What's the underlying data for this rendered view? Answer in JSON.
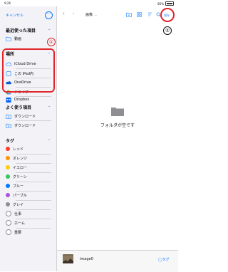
{
  "status": {
    "time": "9:26",
    "right": "85%"
  },
  "sidebar": {
    "cancel": "キャンセル",
    "recent": {
      "header": "最近使った項目",
      "items": [
        {
          "label": "動画"
        }
      ]
    },
    "locations": {
      "header": "場所",
      "items": [
        {
          "label": "iCloud Drive",
          "icon": "cloud-icon"
        },
        {
          "label": "この iPad内",
          "icon": "ipad-icon"
        },
        {
          "label": "OneDrive",
          "icon": "onedrive-icon"
        },
        {
          "label": "ドライブ",
          "icon": "google-drive-icon"
        },
        {
          "label": "Dropbox",
          "icon": "dropbox-icon"
        }
      ]
    },
    "favorites": {
      "header": "よく使う項目",
      "items": [
        {
          "label": "ダウンロード"
        },
        {
          "label": "ダウンロード"
        }
      ]
    },
    "tags": {
      "header": "タグ",
      "items": [
        {
          "label": "レッド",
          "color": "#ff3b30"
        },
        {
          "label": "オレンジ",
          "color": "#ff9500"
        },
        {
          "label": "イエロー",
          "color": "#ffcc00"
        },
        {
          "label": "グリーン",
          "color": "#34c759"
        },
        {
          "label": "ブルー",
          "color": "#007aff"
        },
        {
          "label": "パープル",
          "color": "#af52de"
        },
        {
          "label": "グレイ",
          "color": "#8e8e93"
        },
        {
          "label": "仕事",
          "color": "#ffffff"
        },
        {
          "label": "ホーム",
          "color": "#ffffff"
        },
        {
          "label": "重要",
          "color": "#ffffff"
        }
      ]
    }
  },
  "annotations": {
    "one": "①",
    "two": "②"
  },
  "main": {
    "location": "画像",
    "save": "保存",
    "empty_label": "フォルダが空です"
  },
  "bottom": {
    "filename": "image0",
    "tag": "タグ"
  }
}
